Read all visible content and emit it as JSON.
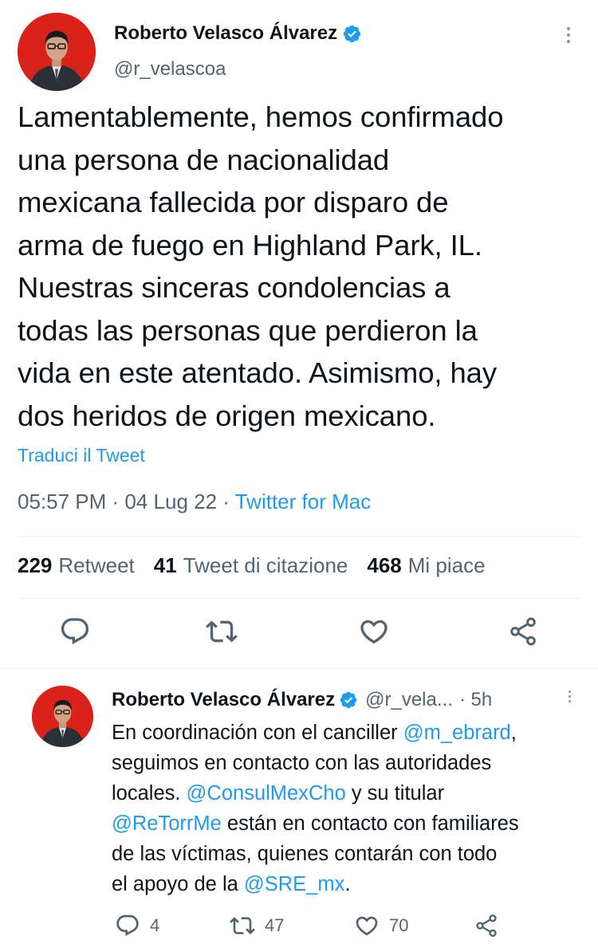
{
  "main_tweet": {
    "display_name": "Roberto Velasco Álvarez",
    "handle": "@r_velascoa",
    "text_lines": [
      "Lamentablemente, hemos confirmado",
      "una persona de nacionalidad",
      "mexicana fallecida por disparo de",
      "arma de fuego en Highland Park, IL.",
      "Nuestras sinceras condolencias a",
      "todas las personas que perdieron la",
      "vida en este atentado. Asimismo, hay",
      "dos heridos de origen mexicano."
    ],
    "translate_label": "Traduci il Tweet",
    "time": "05:57 PM",
    "date": "04 Lug 22",
    "source": "Twitter for Mac",
    "separator": " · ",
    "stats": {
      "retweets_count": "229",
      "retweets_label": "Retweet",
      "quotes_count": "41",
      "quotes_label": "Tweet di citazione",
      "likes_count": "468",
      "likes_label": "Mi piace"
    },
    "actions": [
      "reply-icon",
      "retweet-icon",
      "like-icon",
      "share-icon"
    ]
  },
  "reply_tweet": {
    "display_name": "Roberto Velasco Álvarez",
    "handle_truncated": "@r_vela...",
    "age": "· 5h",
    "lines": [
      [
        {
          "t": "En coordinación con el canciller ",
          "m": false
        },
        {
          "t": "@m_ebrard",
          "m": true
        },
        {
          "t": ",",
          "m": false
        }
      ],
      [
        {
          "t": "seguimos en contacto con las autoridades",
          "m": false
        }
      ],
      [
        {
          "t": "locales. ",
          "m": false
        },
        {
          "t": "@ConsulMexCho",
          "m": true
        },
        {
          "t": " y su titular",
          "m": false
        }
      ],
      [
        {
          "t": "@ReTorrMe",
          "m": true
        },
        {
          "t": " están en contacto con familiares",
          "m": false
        }
      ],
      [
        {
          "t": "de las víctimas, quienes contarán con todo",
          "m": false
        }
      ],
      [
        {
          "t": "el apoyo de la ",
          "m": false
        },
        {
          "t": "@SRE_mx",
          "m": true
        },
        {
          "t": ".",
          "m": false
        }
      ]
    ],
    "reply_count": "4",
    "retweet_count": "47",
    "like_count": "70"
  },
  "colors": {
    "link": "#1d9bf0",
    "secondary_text": "#536471",
    "primary_text": "#0f1419",
    "avatar_background": "#d92219",
    "divider": "#eff3f4"
  }
}
